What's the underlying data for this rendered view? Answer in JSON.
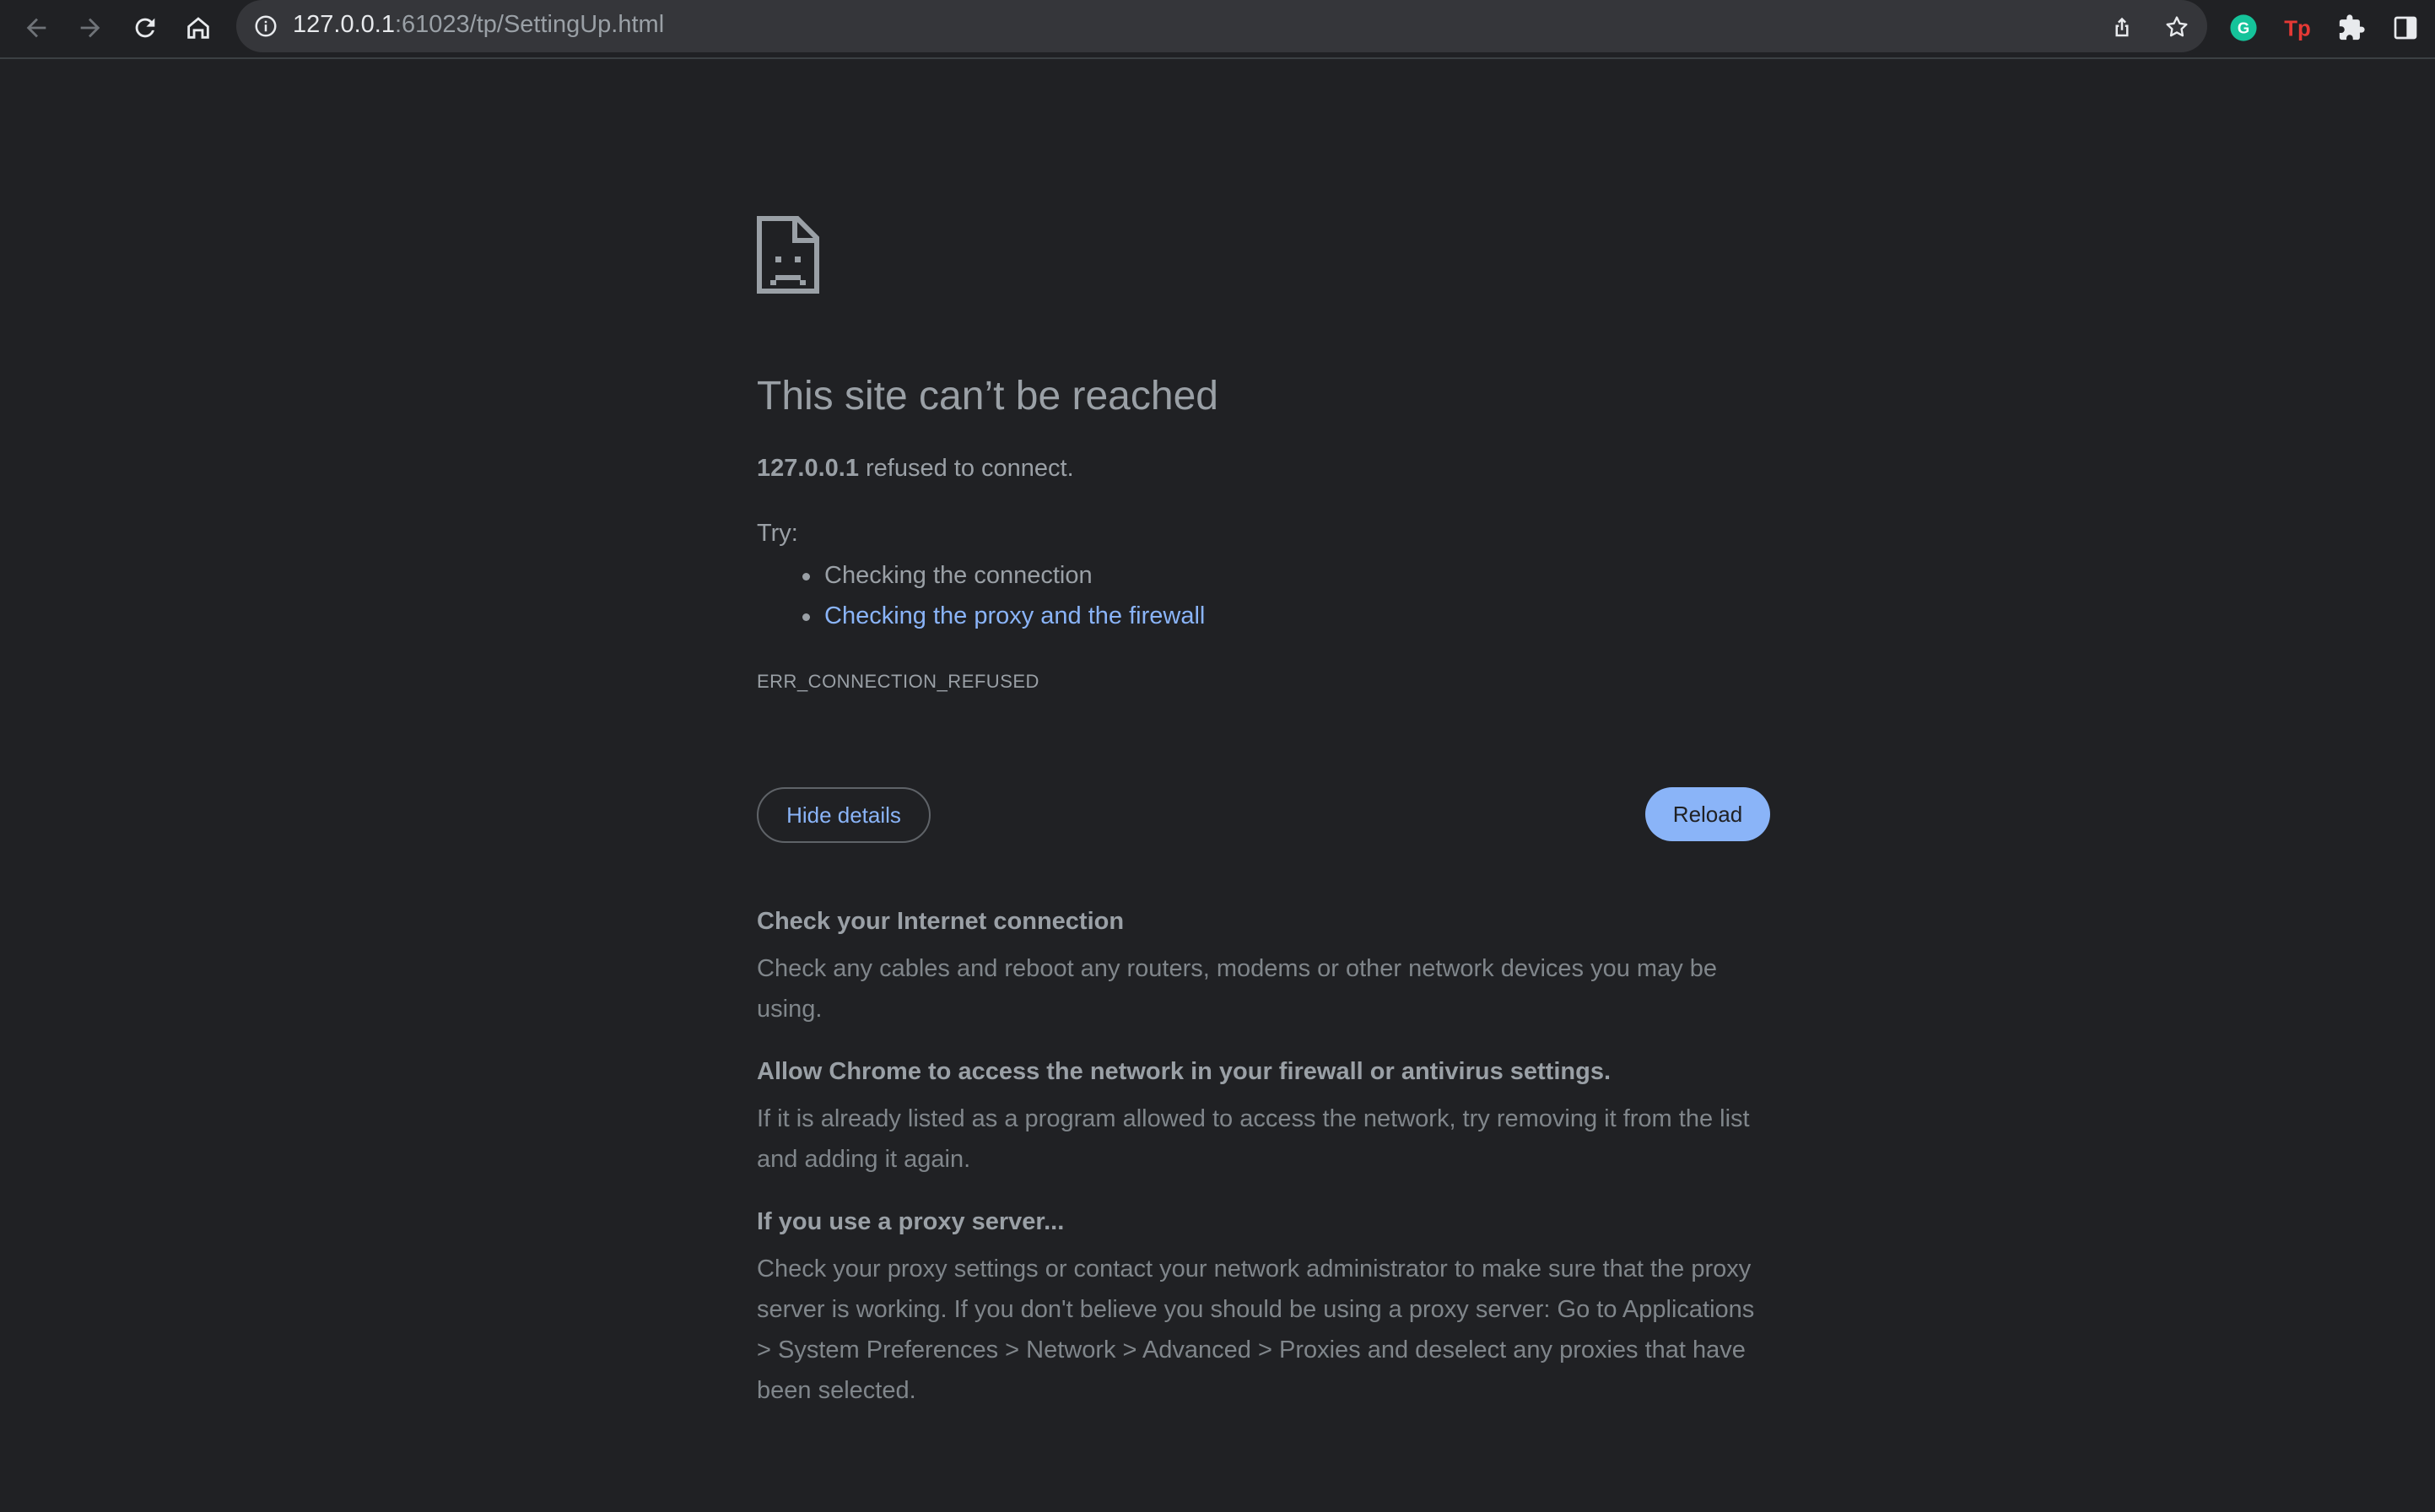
{
  "browser": {
    "address": {
      "host": "127.0.0.1",
      "rest": ":61023/tp/SettingUp.html"
    },
    "icons": {
      "back": "back-arrow-icon",
      "forward": "forward-arrow-icon",
      "reload": "reload-icon",
      "home": "home-icon",
      "info": "info-icon",
      "share": "share-icon",
      "bookmark": "star-icon",
      "grammarly": "grammarly-extension-icon",
      "tp": "tp-extension-icon",
      "extensions": "puzzle-icon",
      "sidepanel": "side-panel-icon"
    },
    "tp_label": "Tp",
    "grammarly_label": "G"
  },
  "error": {
    "headline": "This site can’t be reached",
    "host": "127.0.0.1",
    "summary_rest": " refused to connect.",
    "try_label": "Try:",
    "suggestions": [
      "Checking the connection",
      "Checking the proxy and the firewall"
    ],
    "code": "ERR_CONNECTION_REFUSED",
    "hide_details_label": "Hide details",
    "reload_label": "Reload"
  },
  "details": [
    {
      "title": "Check your Internet connection",
      "body": "Check any cables and reboot any routers, modems or other network devices you may be using."
    },
    {
      "title": "Allow Chrome to access the network in your firewall or antivirus settings.",
      "body": "If it is already listed as a program allowed to access the network, try removing it from the list and adding it again."
    },
    {
      "title": "If you use a proxy server...",
      "body": "Check your proxy settings or contact your network administrator to make sure that the proxy server is working. If you don't believe you should be using a proxy server: Go to Applications > System Preferences > Network > Advanced > Proxies and deselect any proxies that have been selected."
    }
  ],
  "colors": {
    "background": "#202124",
    "text": "#9aa0a6",
    "link": "#8ab4f8",
    "button_primary": "#8ab4f8"
  }
}
